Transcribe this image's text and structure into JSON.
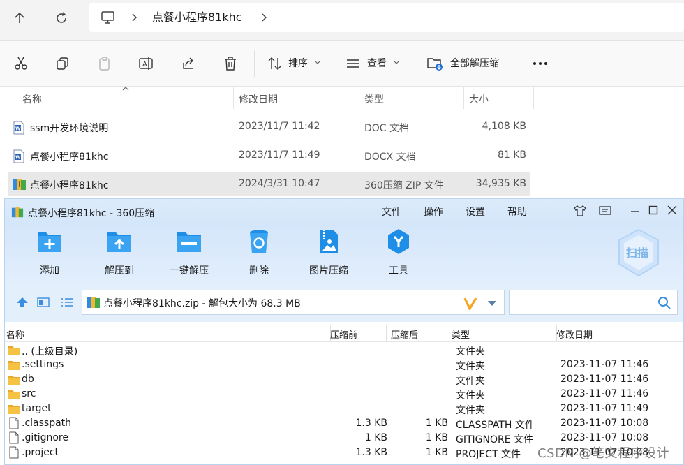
{
  "explorer": {
    "breadcrumb": {
      "folder": "点餐小程序81khc"
    },
    "toolbar": {
      "sort_label": "排序",
      "view_label": "查看",
      "extract_all_label": "全部解压缩"
    },
    "columns": {
      "name": "名称",
      "modified": "修改日期",
      "type": "类型",
      "size": "大小"
    },
    "files": [
      {
        "name": "ssm开发环境说明",
        "modified": "2023/11/7 11:42",
        "type": "DOC 文档",
        "size": "4,108 KB",
        "icon": "word-doc-icon",
        "selected": false
      },
      {
        "name": "点餐小程序81khc",
        "modified": "2023/11/7 11:49",
        "type": "DOCX 文档",
        "size": "81 KB",
        "icon": "word-doc-icon",
        "selected": false
      },
      {
        "name": "点餐小程序81khc",
        "modified": "2024/3/31 10:47",
        "type": "360压缩 ZIP 文件",
        "size": "34,935 KB",
        "icon": "zip-archive-icon",
        "selected": true
      }
    ]
  },
  "zip": {
    "window_title": "点餐小程序81khc - 360压缩",
    "menu": [
      "文件",
      "操作",
      "设置",
      "帮助"
    ],
    "ribbon": [
      {
        "label": "添加",
        "icon": "add-icon"
      },
      {
        "label": "解压到",
        "icon": "extract-to-icon"
      },
      {
        "label": "一键解压",
        "icon": "one-click-extract-icon"
      },
      {
        "label": "删除",
        "icon": "recycle-bin-icon"
      },
      {
        "label": "图片压缩",
        "icon": "image-compress-icon"
      },
      {
        "label": "工具",
        "icon": "tools-icon"
      }
    ],
    "scan_label": "扫描",
    "path_text": "点餐小程序81khc.zip - 解包大小为 68.3 MB",
    "columns": {
      "name": "名称",
      "before": "压缩前",
      "after": "压缩后",
      "type": "类型",
      "modified": "修改日期"
    },
    "rows": [
      {
        "name": ".. (上级目录)",
        "before": "",
        "after": "",
        "type": "文件夹",
        "modified": "",
        "kind": "folder"
      },
      {
        "name": ".settings",
        "before": "",
        "after": "",
        "type": "文件夹",
        "modified": "2023-11-07 11:46",
        "kind": "folder"
      },
      {
        "name": "db",
        "before": "",
        "after": "",
        "type": "文件夹",
        "modified": "2023-11-07 11:46",
        "kind": "folder"
      },
      {
        "name": "src",
        "before": "",
        "after": "",
        "type": "文件夹",
        "modified": "2023-11-07 11:46",
        "kind": "folder"
      },
      {
        "name": "target",
        "before": "",
        "after": "",
        "type": "文件夹",
        "modified": "2023-11-07 11:49",
        "kind": "folder"
      },
      {
        "name": ".classpath",
        "before": "1.3 KB",
        "after": "1 KB",
        "type": "CLASSPATH 文件",
        "modified": "2023-11-07 10:08",
        "kind": "file"
      },
      {
        "name": ".gitignore",
        "before": "1 KB",
        "after": "1 KB",
        "type": "GITIGNORE 文件",
        "modified": "2023-11-07 10:08",
        "kind": "file"
      },
      {
        "name": ".project",
        "before": "1.3 KB",
        "after": "1 KB",
        "type": "PROJECT 文件",
        "modified": "2023-11-07 10:08",
        "kind": "file"
      }
    ]
  },
  "watermark": "CSDN @笔文程序设计",
  "colors": {
    "accent_blue": "#1f8ee6",
    "folder_yellow": "#f6c244",
    "ribbon_bg": "#d4e6fa"
  }
}
